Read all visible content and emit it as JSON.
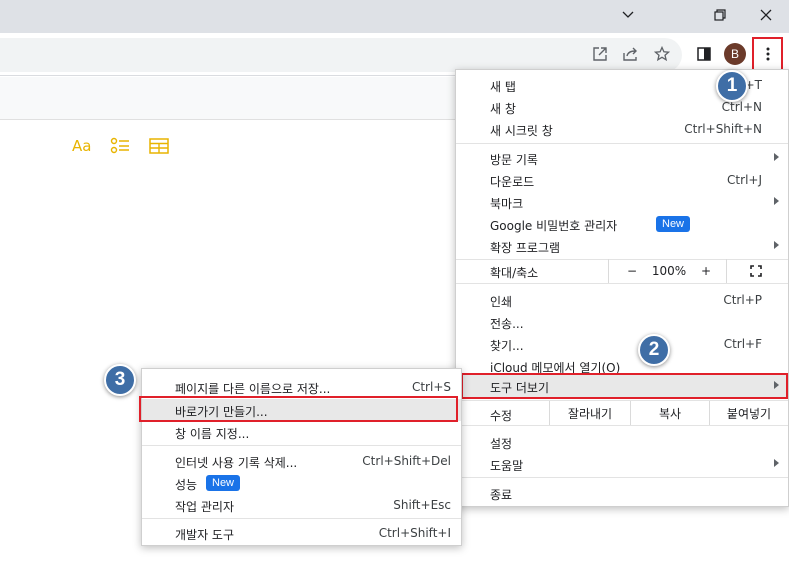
{
  "window_controls": {
    "dropdown_icon": "chevron-down-icon",
    "restore_icon": "restore-icon",
    "close_icon": "close-icon"
  },
  "toolbar": {
    "avatar_letter": "B",
    "icons": [
      "open-in-new-icon",
      "share-icon",
      "star-icon",
      "side-panel-icon",
      "kebab-menu-icon"
    ]
  },
  "doc_toolbar": {
    "text_format_label": "Aa",
    "icons": [
      "text-format-icon",
      "checklist-icon",
      "table-icon"
    ]
  },
  "main_menu": {
    "new_tab": {
      "label": "새 탭",
      "shortcut": "+T"
    },
    "new_window": {
      "label": "새 창",
      "shortcut": "Ctrl+N"
    },
    "incognito": {
      "label": "새 시크릿 창",
      "shortcut": "Ctrl+Shift+N"
    },
    "history": {
      "label": "방문 기록"
    },
    "downloads": {
      "label": "다운로드",
      "shortcut": "Ctrl+J"
    },
    "bookmarks": {
      "label": "북마크"
    },
    "password_manager": {
      "label": "Google 비밀번호 관리자",
      "badge": "New"
    },
    "extensions": {
      "label": "확장 프로그램"
    },
    "zoom": {
      "label": "확대/축소",
      "minus": "−",
      "value": "100%",
      "plus": "+"
    },
    "print": {
      "label": "인쇄",
      "shortcut": "Ctrl+P"
    },
    "cast": {
      "label": "전송..."
    },
    "find": {
      "label": "찾기...",
      "shortcut": "Ctrl+F"
    },
    "icloud": {
      "label": "iCloud 메모에서 열기(O)"
    },
    "more_tools": {
      "label": "도구 더보기"
    },
    "edit": {
      "label": "수정",
      "cut": "잘라내기",
      "copy": "복사",
      "paste": "붙여넣기"
    },
    "settings": {
      "label": "설정"
    },
    "help": {
      "label": "도움말"
    },
    "exit": {
      "label": "종료"
    }
  },
  "submenu": {
    "save_page": {
      "label": "페이지를 다른 이름으로 저장...",
      "shortcut": "Ctrl+S"
    },
    "create_shortcut": {
      "label": "바로가기 만들기..."
    },
    "name_window": {
      "label": "창 이름 지정..."
    },
    "clear_data": {
      "label": "인터넷 사용 기록 삭제...",
      "shortcut": "Ctrl+Shift+Del"
    },
    "performance": {
      "label": "성능",
      "badge": "New"
    },
    "task_manager": {
      "label": "작업 관리자",
      "shortcut": "Shift+Esc"
    },
    "dev_tools": {
      "label": "개발자 도구",
      "shortcut": "Ctrl+Shift+I"
    }
  },
  "step_markers": [
    "1",
    "2",
    "3"
  ],
  "colors": {
    "highlight_red": "#e0202a",
    "step_blue": "#3f6ea6",
    "badge_blue": "#1a73e8",
    "doc_icon_yellow": "#e8b400"
  }
}
